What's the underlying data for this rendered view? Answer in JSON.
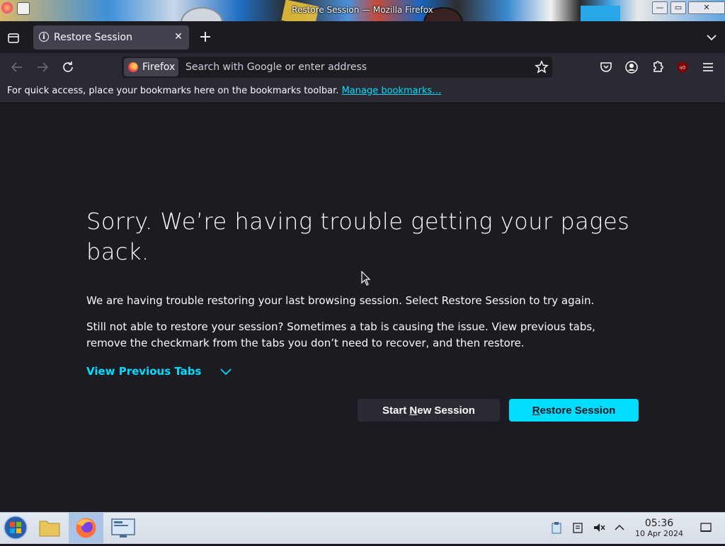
{
  "window": {
    "title": "Restore Session — Mozilla Firefox",
    "controls": {
      "minimize": "—",
      "maximize": "▭",
      "close": "✕"
    }
  },
  "tab": {
    "title": "Restore Session",
    "close_icon": "close-icon"
  },
  "navbar": {
    "identity_label": "Firefox",
    "url_placeholder": "Search with Google or enter address"
  },
  "bookmarks_bar": {
    "text": "For quick access, place your bookmarks here on the bookmarks toolbar. ",
    "link": "Manage bookmarks…"
  },
  "page": {
    "heading": "Sorry. We’re having trouble getting your pages back.",
    "para1": "We are having trouble restoring your last browsing session. Select Restore Session to try again.",
    "para2": "Still not able to restore your session? Sometimes a tab is causing the issue. View previous tabs, remove the checkmark from the tabs you don’t need to recover, and then restore.",
    "view_previous": "View Previous Tabs",
    "start_new_pre": "Start ",
    "start_new_access": "N",
    "start_new_post": "ew Session",
    "restore_access": "R",
    "restore_post": "estore Session"
  },
  "taskbar": {
    "time": "05:36",
    "date": "10 Apr 2024"
  },
  "colors": {
    "accent": "#00ddff",
    "content_bg": "#1c1b22",
    "toolbar_bg": "#2b2a33"
  }
}
